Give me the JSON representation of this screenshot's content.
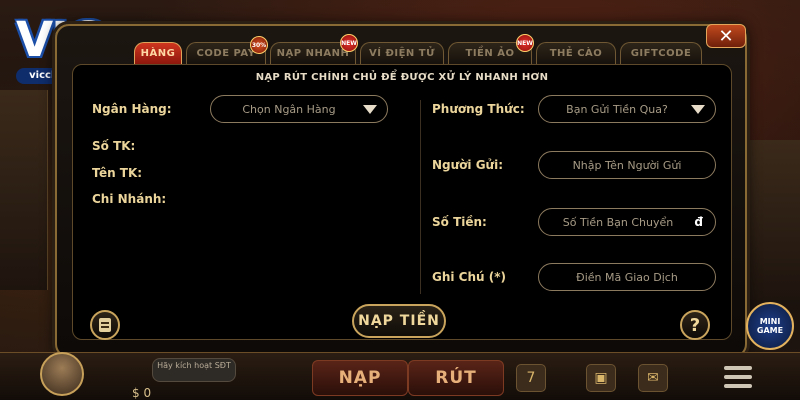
{
  "logo": {
    "brand": "VIC",
    "url": "vicclubb.com"
  },
  "tabs": [
    {
      "label": "HÀNG",
      "active": true
    },
    {
      "label": "CODE PAY",
      "active": false,
      "badge": "30%"
    },
    {
      "label": "NẠP NHANH",
      "active": false,
      "badge": "NEW"
    },
    {
      "label": "VÍ ĐIỆN TỬ",
      "active": false
    },
    {
      "label": "TIỀN ẢO",
      "active": false,
      "badge": "NEW"
    },
    {
      "label": "THẺ CÀO",
      "active": false
    },
    {
      "label": "GIFTCODE",
      "active": false
    }
  ],
  "close_label": "✕",
  "notice": "NẠP RÚT CHÍNH CHỦ ĐỂ ĐƯỢC XỬ LÝ NHANH HƠN",
  "left": {
    "bank_label": "Ngân Hàng:",
    "bank_select": "Chọn Ngân Hàng",
    "account_no_label": "Số TK:",
    "account_name_label": "Tên TK:",
    "branch_label": "Chi Nhánh:"
  },
  "right": {
    "method_label": "Phương Thức:",
    "method_select": "Bạn Gửi Tiền Qua?",
    "sender_label": "Người Gửi:",
    "sender_placeholder": "Nhập Tên Người Gửi",
    "amount_label": "Số Tiền:",
    "amount_placeholder": "Số Tiền Bạn Chuyển",
    "currency_symbol": "đ",
    "note_label": "Ghi Chú (*)",
    "note_placeholder": "Điền Mã Giao Dịch"
  },
  "submit_label": "NẠP TIỀN",
  "help_label": "?",
  "bottom": {
    "activate_text": "Hãy kích hoạt SĐT",
    "balance": "$ 0",
    "nap_label": "NẠP",
    "rut_label": "RÚT",
    "mini_game_label": "MINI GAME"
  },
  "colors": {
    "accent_gold": "#c9a45c",
    "active_tab": "#d0361f",
    "panel_bg": "#000000"
  },
  "icons": [
    "close-icon",
    "caret-down-icon",
    "history-icon",
    "help-icon",
    "menu-icon",
    "gift-icon",
    "mail-icon",
    "slot-icon"
  ]
}
